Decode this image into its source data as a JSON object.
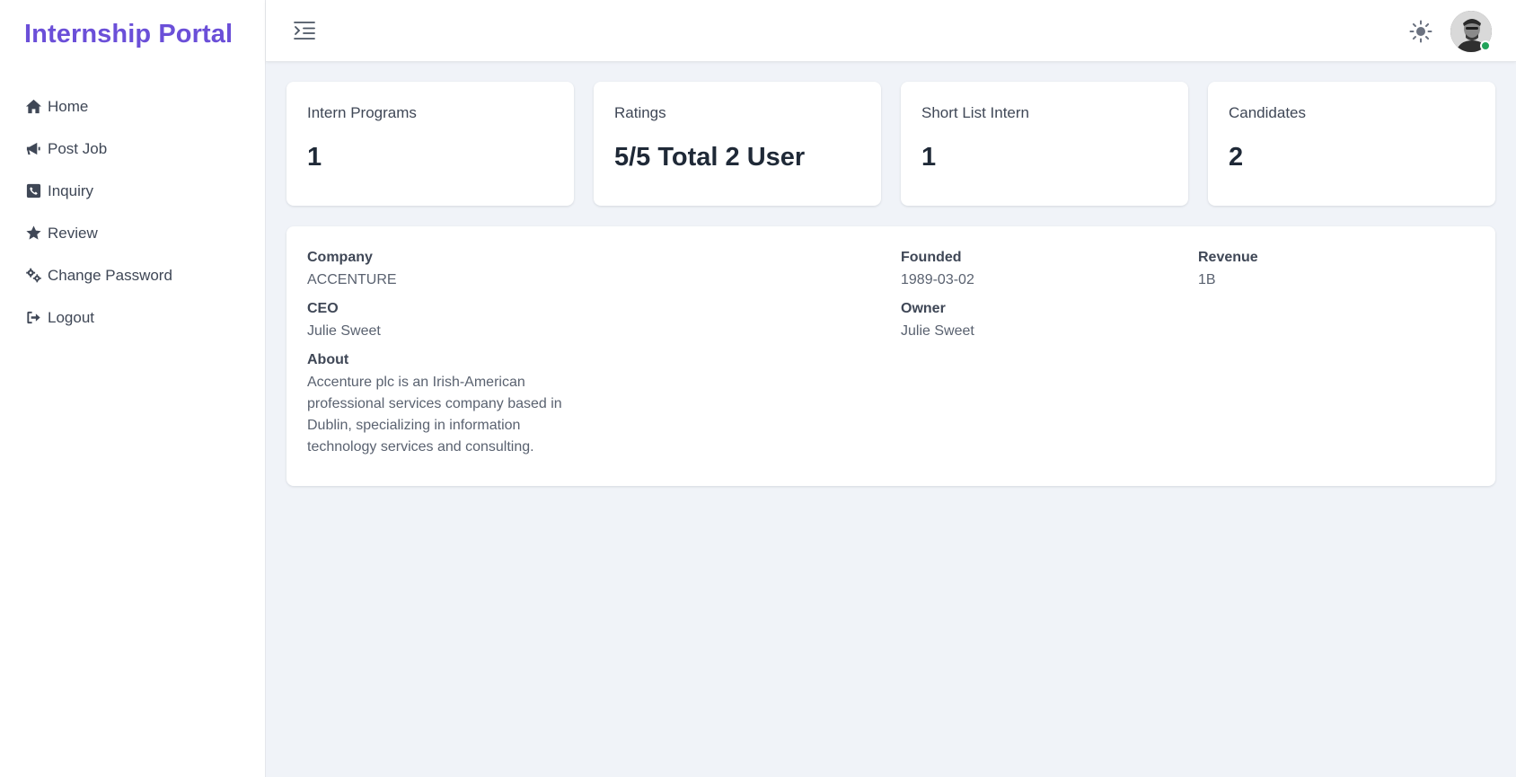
{
  "brand": "Internship Portal",
  "nav": [
    {
      "label": "Home",
      "icon": "home-icon"
    },
    {
      "label": "Post Job",
      "icon": "megaphone-icon"
    },
    {
      "label": "Inquiry",
      "icon": "phone-square-icon"
    },
    {
      "label": "Review",
      "icon": "star-icon"
    },
    {
      "label": "Change Password",
      "icon": "gears-icon"
    },
    {
      "label": "Logout",
      "icon": "logout-icon"
    }
  ],
  "header": {
    "menu_icon": "menu-indent-icon",
    "theme_icon": "sun-icon",
    "status_color": "#22a35a"
  },
  "stats": [
    {
      "label": "Intern Programs",
      "value": "1"
    },
    {
      "label": "Ratings",
      "value": "5/5 Total 2 User"
    },
    {
      "label": "Short List Intern",
      "value": "1"
    },
    {
      "label": "Candidates",
      "value": "2"
    }
  ],
  "company": {
    "company_label": "Company",
    "company_value": "ACCENTURE",
    "ceo_label": "CEO",
    "ceo_value": "Julie Sweet",
    "about_label": "About",
    "about_value": "Accenture plc is an Irish-American professional services company based in Dublin, specializing in information technology services and consulting.",
    "founded_label": "Founded",
    "founded_value": "1989-03-02",
    "owner_label": "Owner",
    "owner_value": "Julie Sweet",
    "revenue_label": "Revenue",
    "revenue_value": "1B"
  },
  "colors": {
    "brand": "#6b4fd8",
    "background": "#f0f3f8"
  }
}
